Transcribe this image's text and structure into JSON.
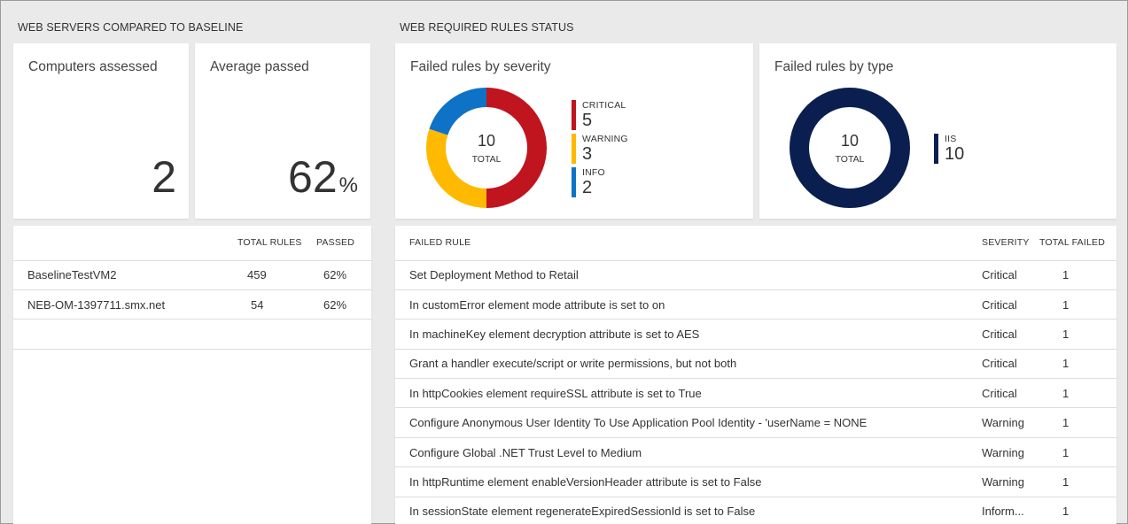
{
  "left_section": {
    "title": "WEB SERVERS COMPARED TO BASELINE",
    "computers_assessed": {
      "label": "Computers assessed",
      "value": "2"
    },
    "average_passed": {
      "label": "Average passed",
      "value": "62",
      "unit": "%"
    },
    "table": {
      "columns": [
        "",
        "TOTAL RULES",
        "PASSED"
      ],
      "rows": [
        {
          "name": "BaselineTestVM2",
          "total_rules": "459",
          "passed": "62%"
        },
        {
          "name": "NEB-OM-1397711.smx.net",
          "total_rules": "54",
          "passed": "62%"
        }
      ]
    }
  },
  "right_section": {
    "title": "WEB REQUIRED RULES STATUS",
    "severity_donut": {
      "title": "Failed rules by severity",
      "center_value": "10",
      "center_label": "TOTAL",
      "segments": [
        {
          "label": "CRITICAL",
          "value": "5",
          "color": "#c0141f"
        },
        {
          "label": "WARNING",
          "value": "3",
          "color": "#ffb900"
        },
        {
          "label": "INFO",
          "value": "2",
          "color": "#0e72c6"
        }
      ]
    },
    "type_donut": {
      "title": "Failed rules by type",
      "center_value": "10",
      "center_label": "TOTAL",
      "segments": [
        {
          "label": "IIS",
          "value": "10",
          "color": "#0a1f4f"
        }
      ]
    },
    "failed_table": {
      "columns": [
        "FAILED RULE",
        "SEVERITY",
        "TOTAL FAILED"
      ],
      "rows": [
        {
          "rule": "Set Deployment Method to Retail",
          "severity": "Critical",
          "total": "1"
        },
        {
          "rule": "In customError element mode attribute is set to on",
          "severity": "Critical",
          "total": "1"
        },
        {
          "rule": "In machineKey element decryption attribute is set to AES",
          "severity": "Critical",
          "total": "1"
        },
        {
          "rule": "Grant a handler execute/script or write permissions, but not both",
          "severity": "Critical",
          "total": "1"
        },
        {
          "rule": "In httpCookies element requireSSL attribute is set to True",
          "severity": "Critical",
          "total": "1"
        },
        {
          "rule": "Configure Anonymous User Identity To Use Application Pool Identity - 'userName = NONE",
          "severity": "Warning",
          "total": "1"
        },
        {
          "rule": "Configure Global .NET Trust Level to Medium",
          "severity": "Warning",
          "total": "1"
        },
        {
          "rule": "In httpRuntime element enableVersionHeader attribute is set to False",
          "severity": "Warning",
          "total": "1"
        },
        {
          "rule": "In sessionState element regenerateExpiredSessionId is set to False",
          "severity": "Inform...",
          "total": "1"
        }
      ]
    }
  }
}
